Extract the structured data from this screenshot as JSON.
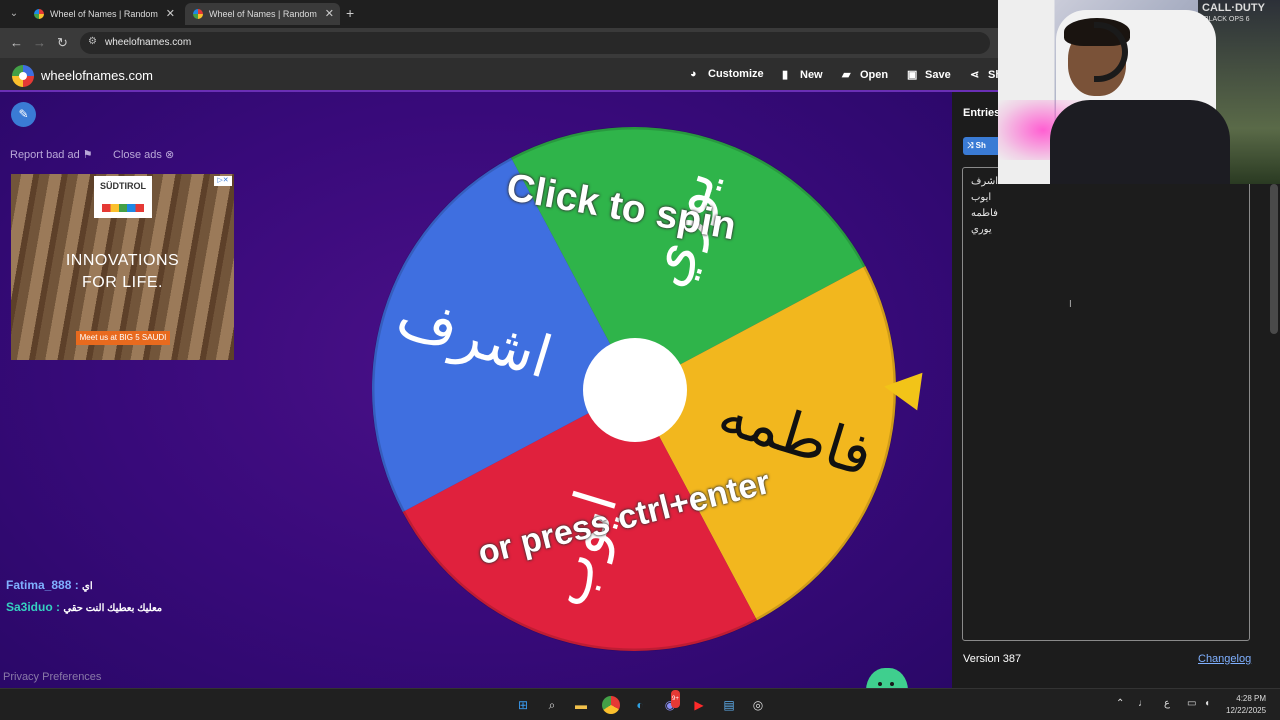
{
  "browser": {
    "tabs": [
      {
        "title": "Wheel of Names | Random name picker"
      },
      {
        "title": "Wheel of Names | Random name picker"
      }
    ],
    "url": "wheelofnames.com"
  },
  "header": {
    "brand": "wheelofnames.com",
    "customize": "Customize",
    "new": "New",
    "open": "Open",
    "save": "Save",
    "share_partial": "Sh"
  },
  "ads": {
    "report_bad_ad": "Report bad ad",
    "close_ads": "Close ads",
    "banner_brand": "SÜDTIROL",
    "banner_text_line1": "INNOVATIONS",
    "banner_text_line2": "FOR LIFE.",
    "banner_cta": "Meet us at BIG 5 SAUDI"
  },
  "wheel": {
    "spin_line1": "Click to spin",
    "spin_line2": "or press ctrl+enter",
    "segments": [
      {
        "label": "يوري",
        "color": "#2fb44a"
      },
      {
        "label": "فاطمه",
        "color": "#f2b71e"
      },
      {
        "label": "ايوب",
        "color": "#e0213d"
      },
      {
        "label": "اشرف",
        "color": "#3f6fe0"
      }
    ],
    "pointer_color": "#f2c418"
  },
  "chat": [
    {
      "user": "Fatima_888",
      "message": "اي"
    },
    {
      "user": "Sa3iduo",
      "message": "معليك بعطيك النت حقي"
    }
  ],
  "footer": {
    "privacy": "Privacy Preferences"
  },
  "sidebar": {
    "tab_entries": "Entries",
    "shuffle_partial": "Sh",
    "entries": [
      "اشرف",
      "ايوب",
      "فاطمه",
      "يوري"
    ],
    "version": "Version 387",
    "changelog": "Changelog"
  },
  "webcam": {
    "poster_title": "CALL·DUTY",
    "poster_sub": "BLACK OPS 6"
  },
  "taskbar": {
    "time": "4:28 PM",
    "date": "12/22/2025",
    "lang": "ع",
    "badge": "9+"
  }
}
